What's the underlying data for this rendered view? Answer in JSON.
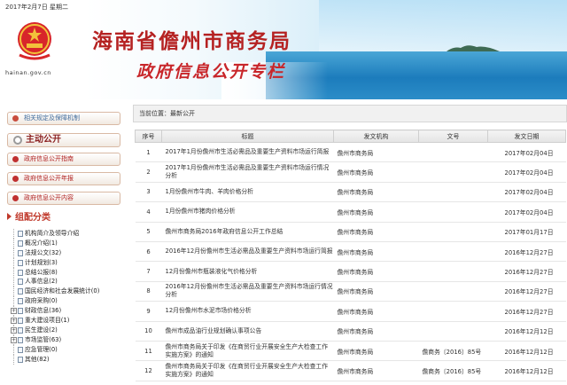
{
  "header": {
    "date_line": "2017年2月7日 星期二",
    "domain": "hainan.gov.cn",
    "site_title": "海南省儋州市商务局",
    "sub_title": "政府信息公开专栏"
  },
  "sidebar": {
    "pill_related": "相关规定及保障机制",
    "main_open": "主动公开",
    "pill_guide": "政府信息公开指南",
    "pill_report": "政府信息公开年报",
    "pill_content": "政府信息公开内容",
    "category_title": "组配分类",
    "tree": [
      {
        "label": "机构简介及领导介绍",
        "node": ""
      },
      {
        "label": "概况介绍(1)",
        "node": ""
      },
      {
        "label": "法规公文(32)",
        "node": ""
      },
      {
        "label": "计划规划(3)",
        "node": ""
      },
      {
        "label": "总结公报(8)",
        "node": ""
      },
      {
        "label": "人事信息(2)",
        "node": ""
      },
      {
        "label": "国民经济和社会发展统计(0)",
        "node": ""
      },
      {
        "label": "政府采购(0)",
        "node": ""
      },
      {
        "label": "财政信息(36)",
        "node": "+"
      },
      {
        "label": "重大建设项目(1)",
        "node": "+"
      },
      {
        "label": "民生建设(2)",
        "node": "+"
      },
      {
        "label": "市场监管(63)",
        "node": "+"
      },
      {
        "label": "应急管理(0)",
        "node": ""
      },
      {
        "label": "其他(82)",
        "node": ""
      }
    ]
  },
  "main": {
    "position_label": "当前位置：最新公开",
    "columns": [
      "序号",
      "标题",
      "发文机构",
      "文号",
      "发文日期"
    ],
    "rows": [
      {
        "no": "1",
        "title": "2017年1月份儋州市生活必需品及重要生产资料市场运行简报",
        "org": "儋州市商务局",
        "docno": "",
        "date": "2017年02月04日"
      },
      {
        "no": "2",
        "title": "2017年1月份儋州市生活必需品及重要生产资料市场运行情况分析",
        "org": "儋州市商务局",
        "docno": "",
        "date": "2017年02月04日"
      },
      {
        "no": "3",
        "title": "1月份儋州市牛肉、羊肉价格分析",
        "org": "儋州市商务局",
        "docno": "",
        "date": "2017年02月04日"
      },
      {
        "no": "4",
        "title": "1月份儋州市猪肉价格分析",
        "org": "儋州市商务局",
        "docno": "",
        "date": "2017年02月04日"
      },
      {
        "no": "5",
        "title": "儋州市商务局2016年政府信息公开工作总结",
        "org": "儋州市商务局",
        "docno": "",
        "date": "2017年01月17日"
      },
      {
        "no": "6",
        "title": "2016年12月份儋州市生活必需品及重要生产资料市场运行简报",
        "org": "儋州市商务局",
        "docno": "",
        "date": "2016年12月27日"
      },
      {
        "no": "7",
        "title": "12月份儋州市瓶装液化气价格分析",
        "org": "儋州市商务局",
        "docno": "",
        "date": "2016年12月27日"
      },
      {
        "no": "8",
        "title": "2016年12月份儋州市生活必需品及重要生产资料市场运行情况分析",
        "org": "儋州市商务局",
        "docno": "",
        "date": "2016年12月27日"
      },
      {
        "no": "9",
        "title": "12月份儋州市水泥市场价格分析",
        "org": "儋州市商务局",
        "docno": "",
        "date": "2016年12月27日"
      },
      {
        "no": "10",
        "title": "儋州市成品油行业规划确认事项公告",
        "org": "儋州市商务局",
        "docno": "",
        "date": "2016年12月12日"
      },
      {
        "no": "11",
        "title": "儋州市商务局关于印发《在商贸行业开展安全生产大检查工作实施方案》的通知",
        "org": "儋州市商务局",
        "docno": "儋商务〔2016〕85号",
        "date": "2016年12月12日"
      },
      {
        "no": "12",
        "title": "儋州市商务局关于印发《在商贸行业开展安全生产大检查工作实施方案》的通知",
        "org": "儋州市商务局",
        "docno": "儋商务〔2016〕85号",
        "date": "2016年12月12日"
      }
    ]
  },
  "colors": {
    "title_red": "#b52222",
    "sea_blue": "#1c7cbc",
    "link_red": "#b02020"
  },
  "icons": [
    "emblem-icon",
    "gear-icon",
    "bullet-icon",
    "folder-node-icon",
    "page-icon"
  ]
}
